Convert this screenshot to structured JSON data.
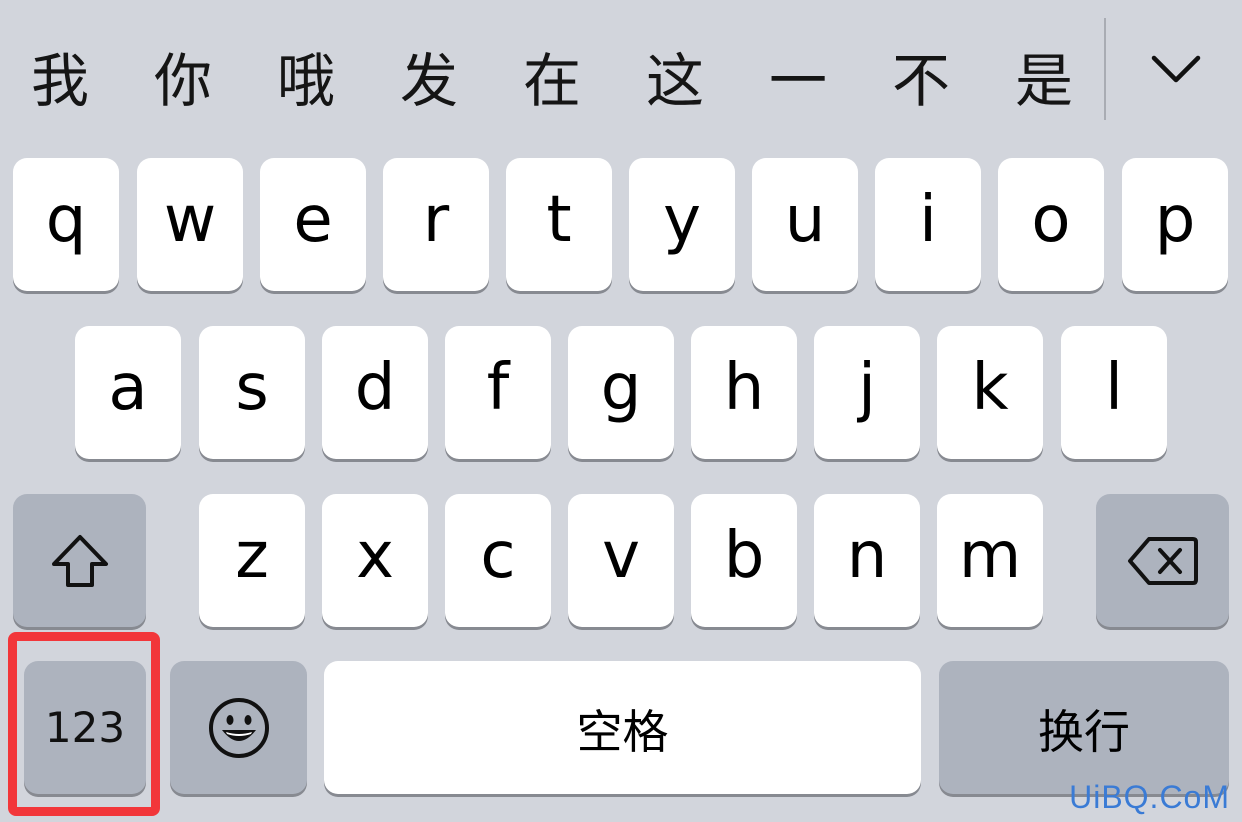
{
  "candidates": [
    "我",
    "你",
    "哦",
    "发",
    "在",
    "这",
    "一",
    "不",
    "是"
  ],
  "collapse_icon": "chevron-down-icon",
  "rows": {
    "row1": [
      "q",
      "w",
      "e",
      "r",
      "t",
      "y",
      "u",
      "i",
      "o",
      "p"
    ],
    "row2": [
      "a",
      "s",
      "d",
      "f",
      "g",
      "h",
      "j",
      "k",
      "l"
    ],
    "row3": [
      "z",
      "x",
      "c",
      "v",
      "b",
      "n",
      "m"
    ]
  },
  "special_keys": {
    "shift_icon": "shift-arrow-icon",
    "delete_icon": "backspace-icon",
    "numbers_label": "123",
    "emoji_icon": "smiley-icon",
    "space_label": "空格",
    "return_label": "换行"
  },
  "highlight": {
    "target": "numbers-key",
    "color": "#f2363a"
  },
  "watermark": "UiBQ.CoM",
  "colors": {
    "keyboard_bg": "#d2d5dc",
    "letter_key": "#ffffff",
    "function_key": "#adb3be",
    "watermark": "#3a7bd5"
  }
}
